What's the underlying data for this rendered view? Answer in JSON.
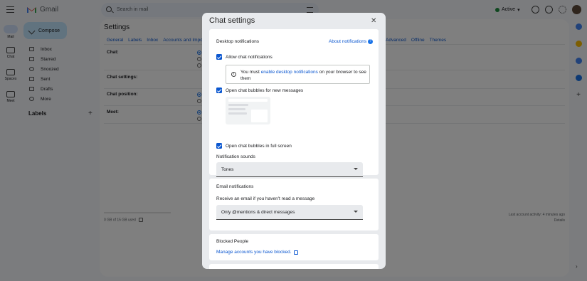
{
  "app": {
    "name": "Gmail"
  },
  "search": {
    "placeholder": "Search in mail"
  },
  "status": {
    "label": "Active"
  },
  "nav": {
    "mail": "Mail",
    "chat": "Chat",
    "spaces": "Spaces",
    "meet": "Meet"
  },
  "compose": {
    "label": "Compose"
  },
  "folders": [
    "Inbox",
    "Starred",
    "Snoozed",
    "Sent",
    "Drafts",
    "More"
  ],
  "labels_header": "Labels",
  "settings": {
    "title": "Settings",
    "tabs_left": [
      "General",
      "Labels",
      "Inbox",
      "Accounts and Import"
    ],
    "tabs_right": [
      "Advanced",
      "Offline",
      "Themes"
    ],
    "rows": [
      "Chat:",
      "Chat settings:",
      "Chat position:",
      "Meet:"
    ]
  },
  "footer": {
    "storage": {
      "used": "0 GB",
      "of_text": "of",
      "total": "15 GB",
      "suffix": "used",
      "fraction": 0.0
    },
    "activity": "Last account activity: 4 minutes ago",
    "details": "Details"
  },
  "dialog": {
    "title": "Chat settings",
    "desktop": {
      "title": "Desktop notifications",
      "about": "About notifications",
      "allow": "Allow chat notifications",
      "info_prefix": "You must",
      "info_link": "enable desktop notifications",
      "info_suffix": "on your browser to see them",
      "bubbles_new": "Open chat bubbles for new messages",
      "bubbles_full": "Open chat bubbles in full screen",
      "sounds_label": "Notification sounds",
      "sounds_value": "Tones"
    },
    "email": {
      "title": "Email notifications",
      "receive": "Receive an email if you haven't read a message",
      "value": "Only @mentions & direct messages"
    },
    "blocked": {
      "title": "Blocked People",
      "manage": "Manage accounts you have blocked."
    }
  },
  "colors": {
    "accent": "#0b57d0",
    "compose_bg": "#c2e7ff",
    "active_green": "#1e8e3e"
  }
}
